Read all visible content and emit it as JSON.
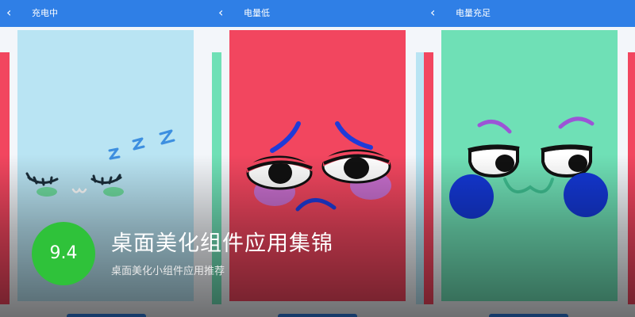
{
  "screens": [
    {
      "title": "充电中",
      "back_icon": "chevron-left-icon",
      "mood": "sleepy"
    },
    {
      "title": "电量低",
      "back_icon": "chevron-left-icon",
      "mood": "sad"
    },
    {
      "title": "电量充足",
      "back_icon": "chevron-left-icon",
      "mood": "content"
    }
  ],
  "face1": {
    "zzz": "Z Z Z"
  },
  "app": {
    "rating": "9.4",
    "name": "桌面美化组件应用集锦",
    "subtitle": "桌面美化小组件应用推荐"
  },
  "colors": {
    "sky": "#b9e4f3",
    "red": "#f2465f",
    "mint": "#6fe0b6",
    "header": "#2f7fe6",
    "rating_badge": "#2fc23a"
  }
}
